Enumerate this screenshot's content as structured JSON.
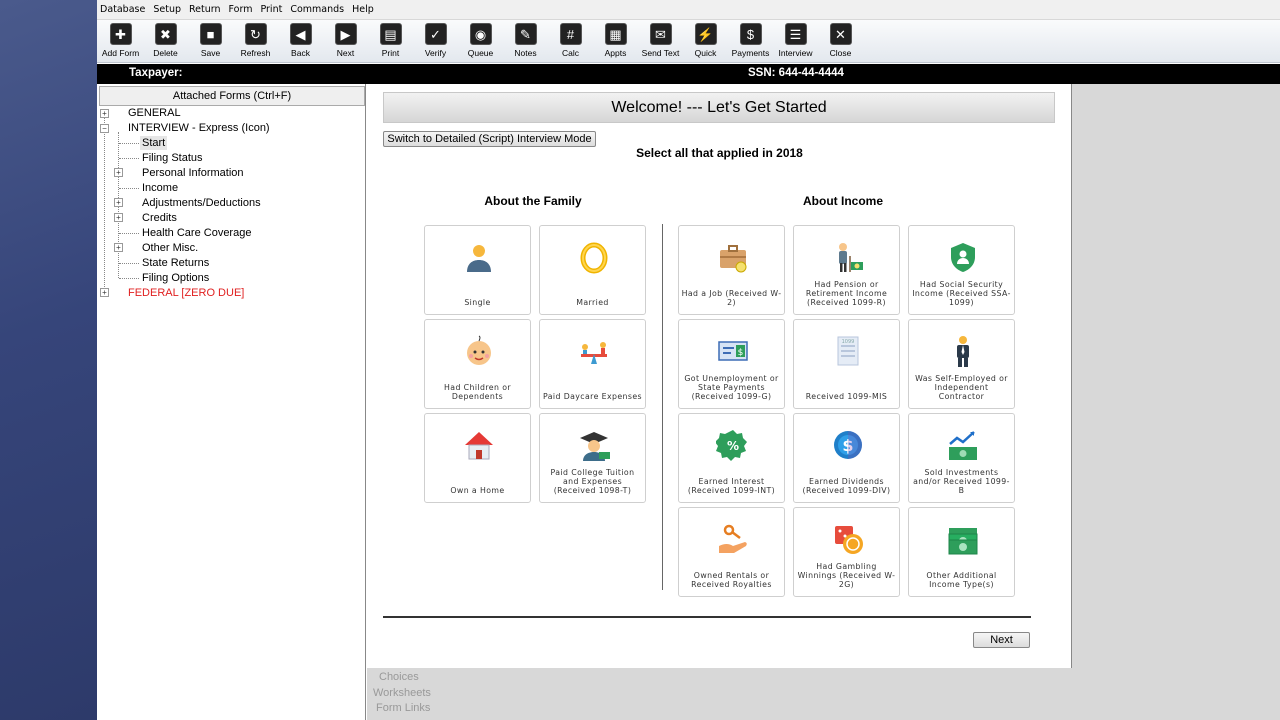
{
  "menu": [
    "Database",
    "Setup",
    "Return",
    "Form",
    "Print",
    "Commands",
    "Help"
  ],
  "toolbar": [
    {
      "label": "Add Form",
      "icon": "add-form-icon",
      "glyph": "✚"
    },
    {
      "label": "Delete",
      "icon": "delete-icon",
      "glyph": "✖"
    },
    {
      "label": "Save",
      "icon": "save-icon",
      "glyph": "■"
    },
    {
      "label": "Refresh",
      "icon": "refresh-icon",
      "glyph": "↻"
    },
    {
      "label": "Back",
      "icon": "back-icon",
      "glyph": "◀"
    },
    {
      "label": "Next",
      "icon": "next-icon",
      "glyph": "▶"
    },
    {
      "label": "Print",
      "icon": "print-icon",
      "glyph": "▤"
    },
    {
      "label": "Verify",
      "icon": "verify-icon",
      "glyph": "✓"
    },
    {
      "label": "Queue",
      "icon": "queue-icon",
      "glyph": "◉"
    },
    {
      "label": "Notes",
      "icon": "notes-icon",
      "glyph": "✎"
    },
    {
      "label": "Calc",
      "icon": "calc-icon",
      "glyph": "#"
    },
    {
      "label": "Appts",
      "icon": "appts-icon",
      "glyph": "▦"
    },
    {
      "label": "Send Text",
      "icon": "send-text-icon",
      "glyph": "✉"
    },
    {
      "label": "Quick",
      "icon": "quick-icon",
      "glyph": "⚡"
    },
    {
      "label": "Payments",
      "icon": "payments-icon",
      "glyph": "$"
    },
    {
      "label": "Interview",
      "icon": "interview-icon",
      "glyph": "☰"
    },
    {
      "label": "Close",
      "icon": "close-icon",
      "glyph": "✕"
    }
  ],
  "infobar": {
    "taxpayer": "Taxpayer:",
    "ssn": "SSN: 644-44-4444"
  },
  "tree": {
    "attached": "Attached Forms (Ctrl+F)",
    "general": "GENERAL",
    "interview": "INTERVIEW - Express (Icon)",
    "items": [
      "Start",
      "Filing Status",
      "Personal Information",
      "Income",
      "Adjustments/Deductions",
      "Credits",
      "Health Care Coverage",
      "Other Misc.",
      "State Returns",
      "Filing Options"
    ],
    "federal": "FEDERAL [ZERO DUE]",
    "federal_color": "#e02020"
  },
  "main": {
    "welcome": "Welcome! --- Let's Get Started",
    "switch_button": "Switch to Detailed (Script) Interview Mode",
    "select_title": "Select all that applied in 2018",
    "family_title": "About the Family",
    "income_title": "About Income",
    "next_button": "Next"
  },
  "family_cards": [
    {
      "label": "Single",
      "icon": "person-icon"
    },
    {
      "label": "Married",
      "icon": "ring-icon"
    },
    {
      "label": "Had Children or Dependents",
      "icon": "baby-icon"
    },
    {
      "label": "Paid Daycare Expenses",
      "icon": "daycare-icon"
    },
    {
      "label": "Own a Home",
      "icon": "house-icon"
    },
    {
      "label": "Paid College Tuition and Expenses (Received 1098-T)",
      "icon": "graduate-icon"
    }
  ],
  "income_cards": [
    {
      "label": "Had a Job (Received W-2)",
      "icon": "briefcase-icon"
    },
    {
      "label": "Had Pension or Retirement Income (Received 1099-R)",
      "icon": "pension-icon"
    },
    {
      "label": "Had Social Security Income (Received SSA-1099)",
      "icon": "shield-icon"
    },
    {
      "label": "Got Unemployment or State Payments (Received 1099-G)",
      "icon": "check-payment-icon"
    },
    {
      "label": "Received 1099-MIS",
      "icon": "form-1099-icon"
    },
    {
      "label": "Was Self-Employed or Independent Contractor",
      "icon": "businessman-icon"
    },
    {
      "label": "Earned Interest (Received 1099-INT)",
      "icon": "percent-badge-icon"
    },
    {
      "label": "Earned Dividends (Received 1099-DIV)",
      "icon": "dollar-coin-icon"
    },
    {
      "label": "Sold Investments and/or Received 1099-B",
      "icon": "investment-chart-icon"
    },
    {
      "label": "Owned Rentals or Received Royalties",
      "icon": "hand-key-icon"
    },
    {
      "label": "Had Gambling Winnings (Received W-2G)",
      "icon": "dice-icon"
    },
    {
      "label": "Other Additional Income Type(s)",
      "icon": "cash-icon"
    }
  ],
  "side_links": [
    "Choices",
    "Worksheets",
    "Form Links"
  ]
}
